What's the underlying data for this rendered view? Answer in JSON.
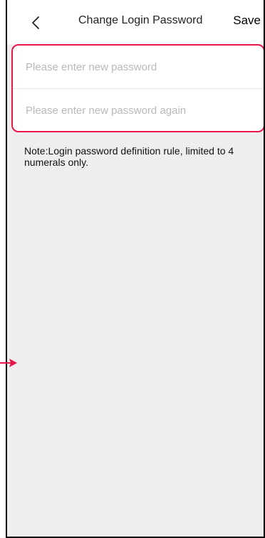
{
  "header": {
    "title": "Change Login Password",
    "save_label": "Save",
    "back_icon": "chevron-left-icon"
  },
  "form": {
    "new_password": {
      "value": "",
      "placeholder": "Please enter new password"
    },
    "confirm_password": {
      "value": "",
      "placeholder": "Please enter new password again"
    }
  },
  "note": "Note:Login password definition rule, limited to 4 numerals only.",
  "colors": {
    "accent": "#e8174a",
    "background": "#eeeeee"
  }
}
